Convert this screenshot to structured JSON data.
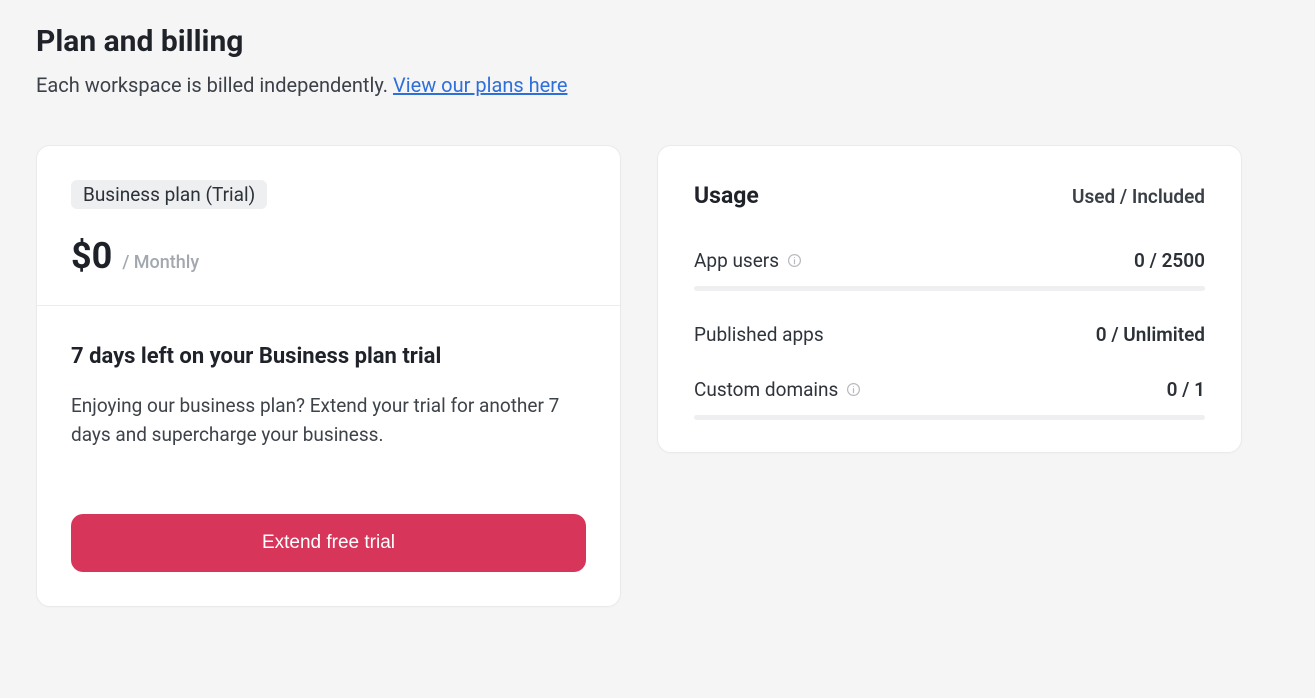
{
  "header": {
    "title": "Plan and billing",
    "subtitle_text": "Each workspace is billed independently. ",
    "plans_link_label": "View our plans here"
  },
  "plan_card": {
    "badge": "Business plan (Trial)",
    "price": "$0",
    "interval": "/ Monthly",
    "trial_heading": "7 days left on your Business plan trial",
    "trial_body": "Enjoying our business plan? Extend your trial for another 7 days and supercharge your business.",
    "extend_button": "Extend free trial"
  },
  "usage_card": {
    "title": "Usage",
    "columns_label": "Used / Included",
    "items": [
      {
        "label": "App users",
        "value": "0 / 2500",
        "has_info": true,
        "has_bar": true
      },
      {
        "label": "Published apps",
        "value": "0 / Unlimited",
        "has_info": false,
        "has_bar": false
      },
      {
        "label": "Custom domains",
        "value": "0 / 1",
        "has_info": true,
        "has_bar": true
      }
    ]
  }
}
